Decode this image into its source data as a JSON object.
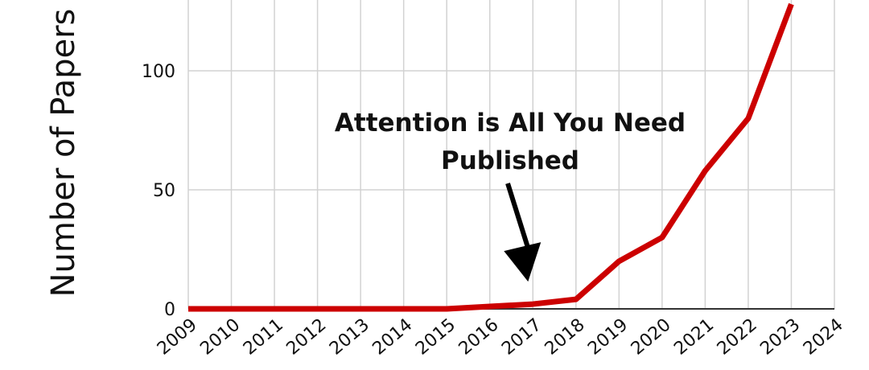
{
  "chart_data": {
    "type": "line",
    "x": [
      2009,
      2010,
      2011,
      2012,
      2013,
      2014,
      2015,
      2016,
      2017,
      2018,
      2019,
      2020,
      2021,
      2022,
      2023
    ],
    "series": [
      {
        "values": [
          0,
          0,
          0,
          0,
          0,
          0,
          0,
          1,
          2,
          4,
          20,
          30,
          58,
          80,
          128
        ]
      }
    ],
    "xticks": [
      "2009",
      "2010",
      "2011",
      "2012",
      "2013",
      "2014",
      "2015",
      "2016",
      "2017",
      "2018",
      "2019",
      "2020",
      "2021",
      "2022",
      "2023",
      "2024"
    ],
    "yticks": [
      "0",
      "50",
      "100"
    ],
    "ylabel": "Number of Papers",
    "xlim": [
      2009,
      2024
    ],
    "ylim": [
      0,
      128
    ],
    "grid": true,
    "line_color": "#cc0000",
    "annotation": {
      "line1": "Attention is All You Need",
      "line2": "Published",
      "target_x": 2017,
      "target_y": 2
    }
  }
}
